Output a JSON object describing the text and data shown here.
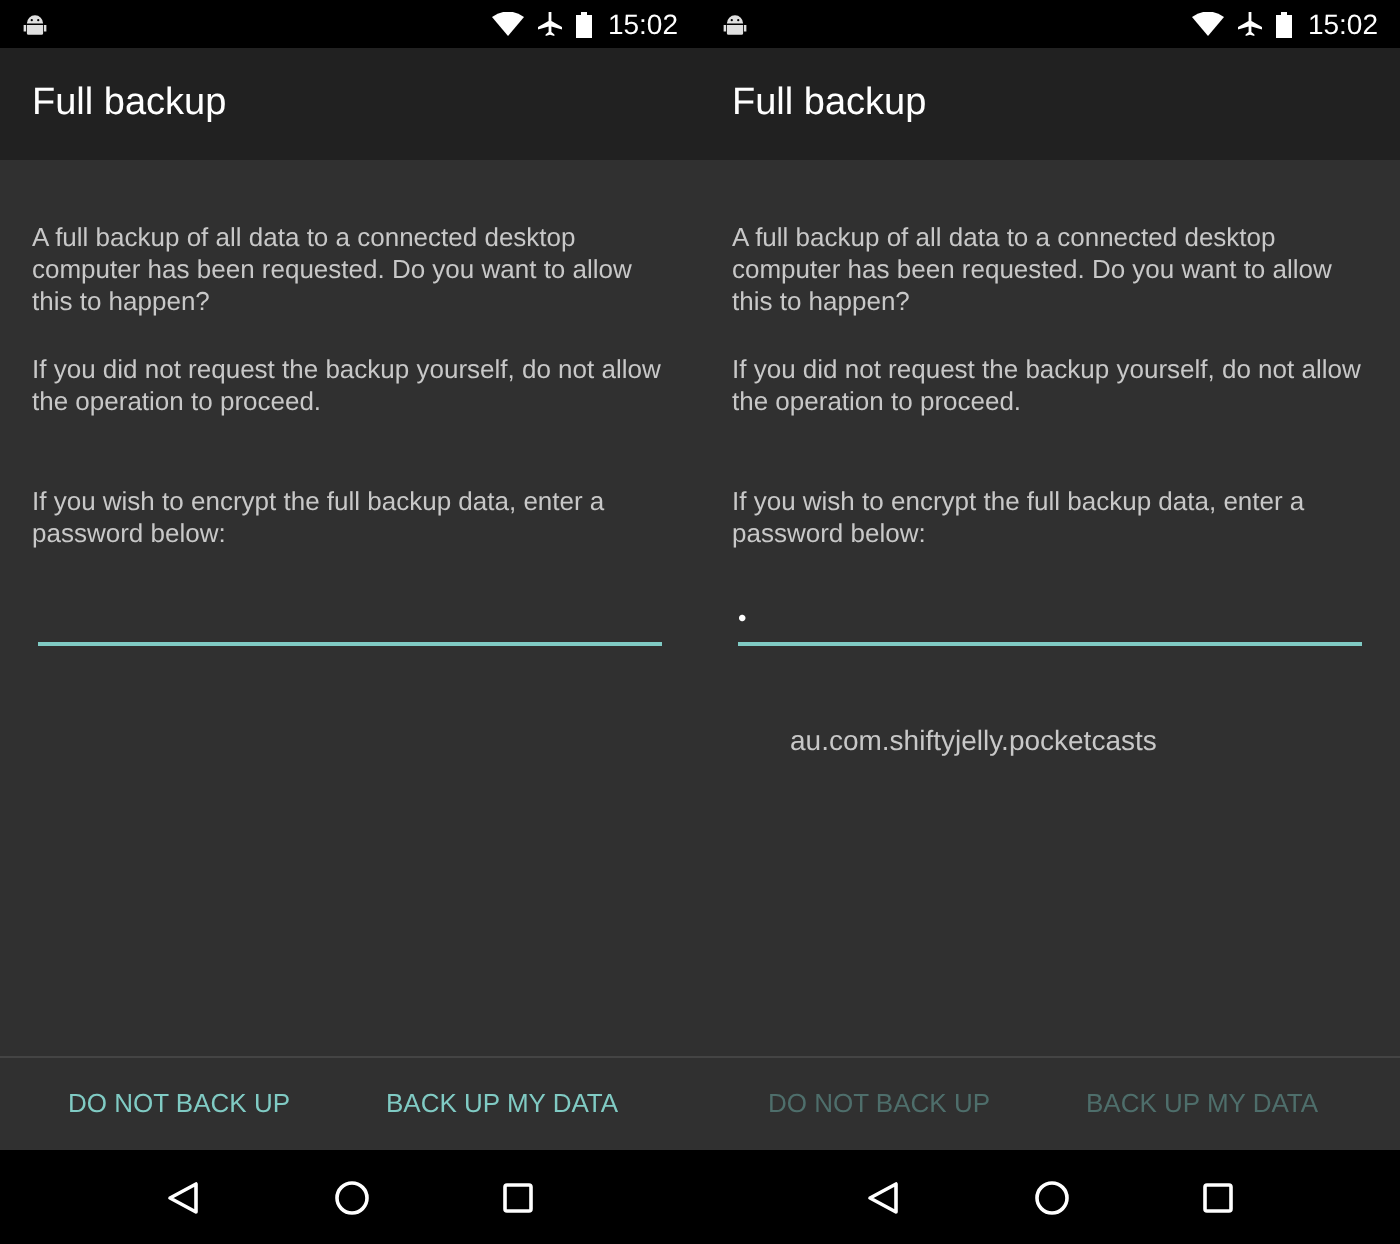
{
  "screens": [
    {
      "status_bar": {
        "time": "15:02"
      },
      "title": "Full backup",
      "paragraphs": [
        "A full backup of all data to a connected desktop computer has been requested. Do you want to allow this to happen?",
        "If you did not request the backup yourself, do not allow the operation to proceed.",
        "If you wish to encrypt the full backup data, enter a password below:"
      ],
      "buttons": [
        {
          "label": "DO NOT BACK UP",
          "disabled": false
        },
        {
          "label": "BACK UP MY DATA",
          "disabled": false
        }
      ]
    },
    {
      "status_bar": {
        "time": "15:02"
      },
      "title": "Full backup",
      "paragraphs": [
        "A full backup of all data to a connected desktop computer has been requested. Do you want to allow this to happen?",
        "If you did not request the backup yourself, do not allow the operation to proceed.",
        "If you wish to encrypt the full backup data, enter a password below:"
      ],
      "password": {
        "value": "•"
      },
      "package": "au.com.shiftyjelly.pocketcasts",
      "buttons": [
        {
          "label": "DO NOT BACK UP",
          "disabled": true
        },
        {
          "label": "BACK UP MY DATA",
          "disabled": true
        }
      ]
    }
  ]
}
